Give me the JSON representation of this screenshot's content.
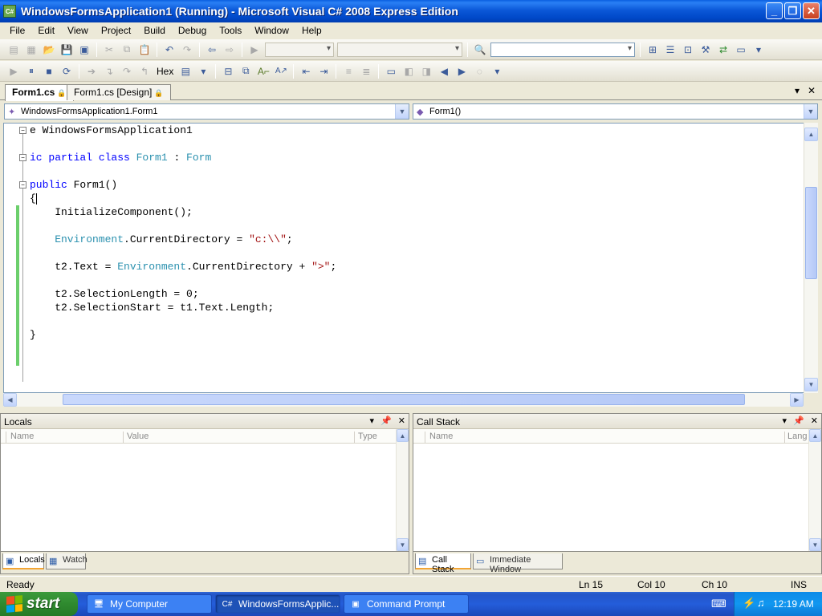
{
  "window": {
    "title": "WindowsFormsApplication1 (Running) - Microsoft Visual C# 2008 Express Edition",
    "icon": "csharp-project-icon",
    "controls": {
      "minimize": "_",
      "restore": "❐",
      "close": "✕"
    }
  },
  "menu": [
    "File",
    "Edit",
    "View",
    "Project",
    "Build",
    "Debug",
    "Tools",
    "Window",
    "Help"
  ],
  "debug_toolbar": {
    "hex_label": "Hex"
  },
  "tabs": [
    {
      "label": "Form1.cs",
      "active": true
    },
    {
      "label": "Form1.cs [Design]",
      "active": false
    }
  ],
  "nav": {
    "type_selector": "WindowsFormsApplication1.Form1",
    "member_selector": "Form1()"
  },
  "code": {
    "lines": [
      {
        "parts": [
          [
            "",
            "e "
          ],
          [
            "",
            "WindowsFormsApplication1"
          ]
        ]
      },
      {
        "parts": [
          [
            "kw",
            "ic partial class "
          ],
          [
            "ty",
            "Form1"
          ],
          [
            "",
            " : "
          ],
          [
            "ty",
            "Form"
          ]
        ]
      },
      {
        "parts": [
          [
            "kw",
            "public "
          ],
          [
            "",
            "Form1()"
          ]
        ]
      },
      {
        "parts": [
          [
            "",
            "{"
          ]
        ]
      },
      {
        "parts": [
          [
            "",
            "    InitializeComponent();"
          ]
        ]
      },
      {
        "parts": [
          [
            "ty",
            "    Environment"
          ],
          [
            "",
            ".CurrentDirectory = "
          ],
          [
            "st",
            "\"c:\\\\\""
          ],
          [
            "",
            ";"
          ]
        ]
      },
      {
        "parts": [
          [
            "",
            "    t2.Text = "
          ],
          [
            "ty",
            "Environment"
          ],
          [
            "",
            ".CurrentDirectory + "
          ],
          [
            "st",
            "\">\""
          ],
          [
            "",
            ";"
          ]
        ]
      },
      {
        "parts": [
          [
            "",
            "    t2.SelectionLength = 0;"
          ]
        ]
      },
      {
        "parts": [
          [
            "",
            "    t2.SelectionStart = t1.Text.Length;"
          ]
        ]
      },
      {
        "parts": [
          [
            "",
            "}"
          ]
        ]
      }
    ]
  },
  "locals": {
    "title": "Locals",
    "columns": [
      "Name",
      "Value",
      "Type"
    ],
    "tabs": [
      "Locals",
      "Watch"
    ]
  },
  "callstack": {
    "title": "Call Stack",
    "columns": [
      "Name",
      "Lang"
    ],
    "tabs": [
      "Call Stack",
      "Immediate Window"
    ]
  },
  "status": {
    "ready": "Ready",
    "line": "Ln 15",
    "col": "Col 10",
    "ch": "Ch 10",
    "mode": "INS"
  },
  "taskbar": {
    "start": "start",
    "items": [
      {
        "label": "My Computer",
        "icon": "my-computer-icon",
        "active": false
      },
      {
        "label": "WindowsFormsApplic...",
        "icon": "visual-studio-icon",
        "active": true
      },
      {
        "label": "Command Prompt",
        "icon": "command-prompt-icon",
        "active": false
      }
    ],
    "clock": "12:19 AM"
  }
}
